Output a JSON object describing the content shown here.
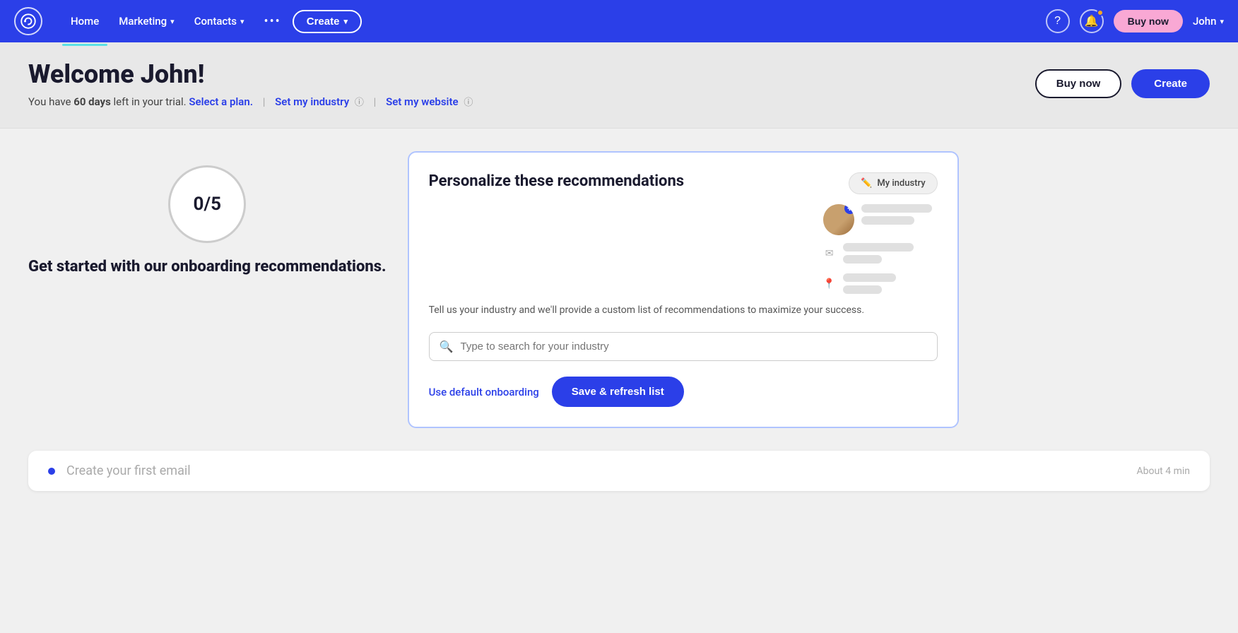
{
  "nav": {
    "logo_alt": "Constant Contact logo",
    "links": [
      {
        "label": "Home",
        "active": true
      },
      {
        "label": "Marketing",
        "hasDropdown": true
      },
      {
        "label": "Contacts",
        "hasDropdown": true
      }
    ],
    "dots": "•••",
    "create_label": "Create",
    "help_icon": "?",
    "buy_now_label": "Buy now",
    "user_label": "John"
  },
  "header": {
    "welcome": "Welcome John!",
    "trial_prefix": "You have ",
    "trial_bold": "60 days",
    "trial_suffix": " left in your trial.",
    "select_plan_label": "Select a plan.",
    "set_industry_label": "Set my industry",
    "set_website_label": "Set my website",
    "buy_now_label": "Buy now",
    "create_label": "Create"
  },
  "progress": {
    "value": "0/5",
    "label": "Get started with our onboarding recommendations."
  },
  "card": {
    "title": "Personalize these recommendations",
    "description": "Tell us your industry and we'll provide a custom list of recommendations to maximize your success.",
    "my_industry_label": "My industry",
    "search_placeholder": "Type to search for your industry",
    "default_link_label": "Use default onboarding",
    "save_btn_label": "Save & refresh list"
  },
  "bottom_item": {
    "label": "Create your first email",
    "time": "About 4 min"
  }
}
